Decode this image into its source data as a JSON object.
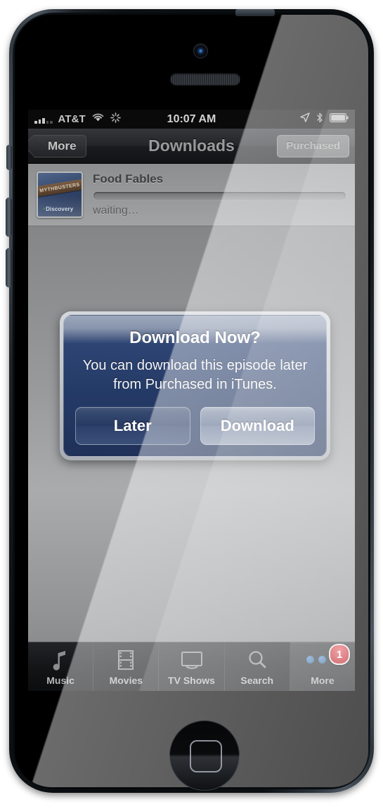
{
  "status_bar": {
    "carrier": "AT&T",
    "time": "10:07 AM",
    "icons": [
      "signal-bars-icon",
      "wifi-icon",
      "activity-spinner-icon",
      "location-arrow-icon",
      "bluetooth-icon",
      "battery-icon"
    ]
  },
  "nav_bar": {
    "back_label": "More",
    "title": "Downloads",
    "right_button": "Purchased"
  },
  "download_row": {
    "title": "Food Fables",
    "status": "waiting…",
    "progress_percent": 0,
    "artwork_banner": "MYTHBUSTERS",
    "artwork_network": "Discovery"
  },
  "alert": {
    "title": "Download Now?",
    "message": "You can download this episode later from Purchased in iTunes.",
    "cancel_label": "Later",
    "confirm_label": "Download"
  },
  "tab_bar": {
    "tabs": [
      {
        "label": "Music",
        "icon": "music-note-icon",
        "selected": false
      },
      {
        "label": "Movies",
        "icon": "film-strip-icon",
        "selected": false
      },
      {
        "label": "TV Shows",
        "icon": "television-icon",
        "selected": false
      },
      {
        "label": "Search",
        "icon": "magnifier-icon",
        "selected": false
      },
      {
        "label": "More",
        "icon": "three-dots-icon",
        "selected": true,
        "badge": "1"
      }
    ]
  },
  "colors": {
    "alert_accent": "#243a66",
    "badge_red": "#b4121b",
    "dot_blue": "#2e5f95"
  }
}
